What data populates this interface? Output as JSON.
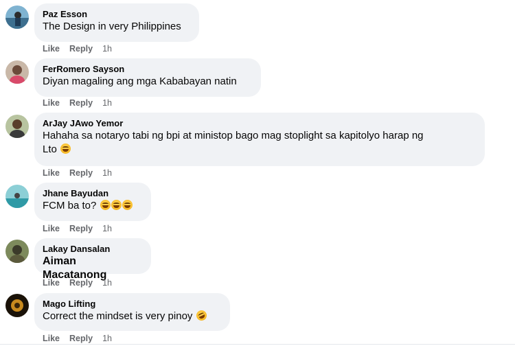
{
  "comments": [
    {
      "author": "Paz Esson",
      "text": "The Design in very Philippines",
      "like": "Like",
      "reply": "Reply",
      "time": "1h"
    },
    {
      "author": "FerRomero Sayson",
      "text": "Diyan magaling ang mga Kababayan natin",
      "like": "Like",
      "reply": "Reply",
      "time": "1h"
    },
    {
      "author": "ArJay JAwo Yemor",
      "text_line1": "Hahaha sa notaryo tabi ng bpi at ministop bago mag stoplight sa kapitolyo harap ng",
      "text_line2": "Lto",
      "like": "Like",
      "reply": "Reply",
      "time": "1h",
      "emoji": "laughing-emoji"
    },
    {
      "author": "Jhane Bayudan",
      "text": "FCM ba to?",
      "like": "Like",
      "reply": "Reply",
      "time": "1h",
      "emoji": "laughing-emoji"
    },
    {
      "author": "Lakay Dansalan",
      "text": "Aiman Macatanong",
      "like": "Like",
      "reply": "Reply",
      "time": "1h"
    },
    {
      "author": "Mago Lifting",
      "text": "Correct the mindset is very pinoy",
      "like": "Like",
      "reply": "Reply",
      "time": "1h",
      "emoji": "rofl-emoji"
    }
  ],
  "colors": {
    "bubble": "#f0f2f5",
    "meta": "#65676b",
    "text": "#050505"
  }
}
